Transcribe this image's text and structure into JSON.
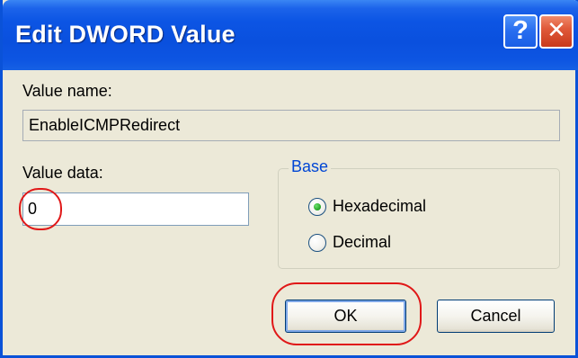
{
  "dialog": {
    "title": "Edit DWORD Value",
    "help_button": "?",
    "close_button": "✕"
  },
  "value_name": {
    "label": "Value name:",
    "value": "EnableICMPRedirect"
  },
  "value_data": {
    "label": "Value data:",
    "value": "0"
  },
  "base": {
    "legend": "Base",
    "options": [
      {
        "label": "Hexadecimal",
        "selected": true
      },
      {
        "label": "Decimal",
        "selected": false
      }
    ]
  },
  "buttons": {
    "ok": "OK",
    "cancel": "Cancel"
  },
  "colors": {
    "titlebar": "#0a50de",
    "dialog_bg": "#ece9d8",
    "highlight": "#e01818",
    "group_legend": "#0046d5"
  },
  "icons": {
    "help": "question-mark-icon",
    "close": "close-x-icon"
  }
}
